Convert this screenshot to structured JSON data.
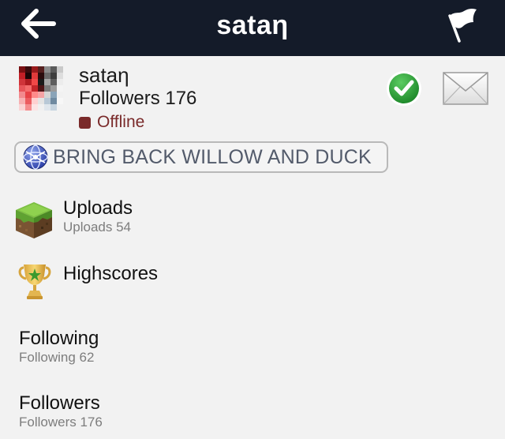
{
  "header": {
    "title": "sataη",
    "back_icon": "back-arrow-icon",
    "report_icon": "flag-icon",
    "background": "#141b29"
  },
  "profile": {
    "name": "sataη",
    "followers_text": "Followers 176",
    "status": "Offline",
    "status_color": "#7a2a2a",
    "follow_icon": "checkmark-icon",
    "follow_color": "#2f9a3a",
    "message_icon": "envelope-icon"
  },
  "badge": {
    "text": "BRING BACK WILLOW AND DUCK",
    "icon": "globe-badge-icon"
  },
  "menu": {
    "uploads": {
      "title": "Uploads",
      "subtitle": "Uploads 54",
      "icon": "grass-block-icon"
    },
    "highscores": {
      "title": "Highscores",
      "icon": "trophy-icon"
    },
    "following": {
      "title": "Following",
      "subtitle": "Following 62"
    },
    "followers": {
      "title": "Followers",
      "subtitle": "Followers 176"
    }
  }
}
